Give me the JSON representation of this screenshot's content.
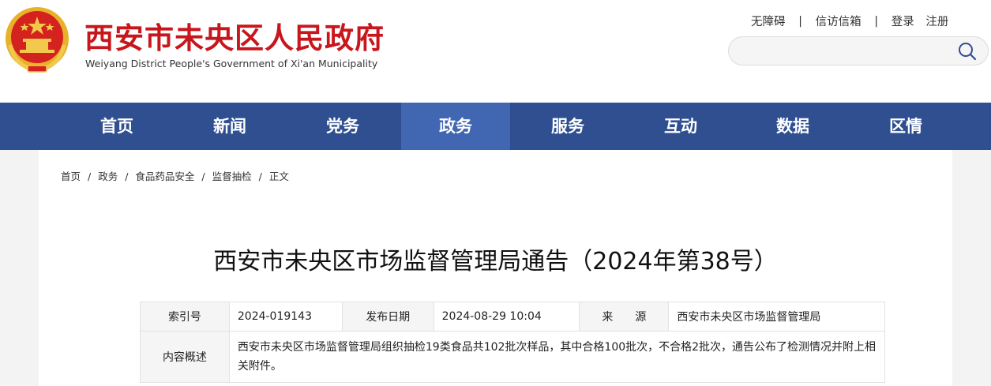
{
  "header": {
    "title": "西安市未央区人民政府",
    "subtitle": "Weiyang District People's Government of  Xi'an  Municipality",
    "links": {
      "accessibility": "无障碍",
      "petition": "信访信箱",
      "login": "登录",
      "register": "注册",
      "separator": "|"
    },
    "search": {
      "placeholder": ""
    },
    "colors": {
      "title": "#c8161d",
      "nav": "#2f4f91",
      "nav_active": "#4267b2"
    }
  },
  "nav": {
    "items": [
      {
        "label": "首页"
      },
      {
        "label": "新闻"
      },
      {
        "label": "党务"
      },
      {
        "label": "政务"
      },
      {
        "label": "服务"
      },
      {
        "label": "互动"
      },
      {
        "label": "数据"
      },
      {
        "label": "区情"
      }
    ],
    "active_index": 3
  },
  "breadcrumb": {
    "items": [
      "首页",
      "政务",
      "食品药品安全",
      "监督抽检",
      "正文"
    ],
    "separator": "/"
  },
  "article": {
    "title": "西安市未央区市场监督管理局通告（2024年第38号）"
  },
  "info": {
    "index_label": "索引号",
    "index_value": "2024-019143",
    "date_label": "发布日期",
    "date_value": "2024-08-29 10:04",
    "source_label": "来　　源",
    "source_value": "西安市未央区市场监督管理局",
    "summary_label": "内容概述",
    "summary_value": "西安市未央区市场监督管理局组织抽检19类食品共102批次样品，其中合格100批次，不合格2批次，通告公布了检测情况并附上相关附件。"
  },
  "icons": {
    "emblem": "national-emblem-icon",
    "search": "search-icon"
  }
}
